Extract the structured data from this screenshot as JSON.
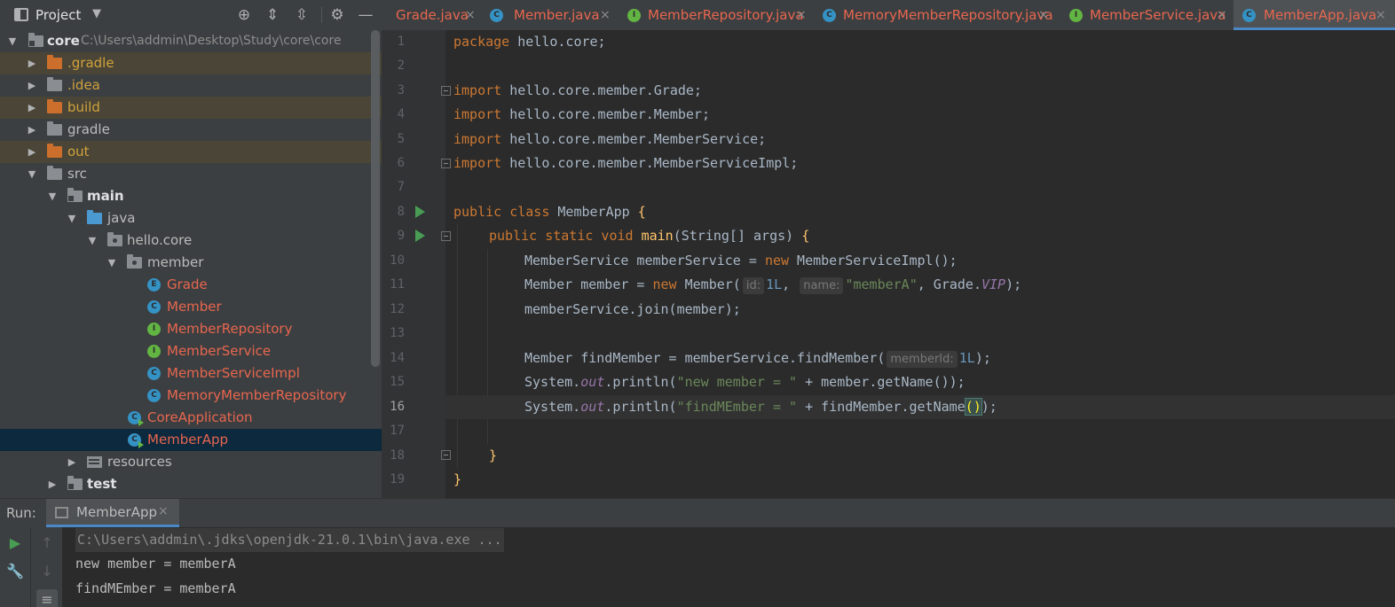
{
  "project_panel": {
    "title": "Project",
    "tree": [
      {
        "label": "core",
        "path": "C:\\Users\\addmin\\Desktop\\Study\\core\\core"
      },
      {
        "label": ".gradle"
      },
      {
        "label": ".idea"
      },
      {
        "label": "build"
      },
      {
        "label": "gradle"
      },
      {
        "label": "out"
      },
      {
        "label": "src"
      },
      {
        "label": "main"
      },
      {
        "label": "java"
      },
      {
        "label": "hello.core"
      },
      {
        "label": "member"
      },
      {
        "label": "Grade"
      },
      {
        "label": "Member"
      },
      {
        "label": "MemberRepository"
      },
      {
        "label": "MemberService"
      },
      {
        "label": "MemberServiceImpl"
      },
      {
        "label": "MemoryMemberRepository"
      },
      {
        "label": "CoreApplication"
      },
      {
        "label": "MemberApp"
      },
      {
        "label": "resources"
      },
      {
        "label": "test"
      }
    ]
  },
  "editor_tabs": [
    {
      "label": "Grade.java",
      "icon": "enum-icon"
    },
    {
      "label": "Member.java",
      "icon": "class-icon"
    },
    {
      "label": "MemberRepository.java",
      "icon": "interface-icon"
    },
    {
      "label": "MemoryMemberRepository.java",
      "icon": "class-icon"
    },
    {
      "label": "MemberService.java",
      "icon": "interface-icon"
    },
    {
      "label": "MemberApp.java",
      "icon": "runnable-class-icon",
      "active": true
    }
  ],
  "editor": {
    "current_line": 16,
    "line_numbers": [
      "1",
      "2",
      "3",
      "4",
      "5",
      "6",
      "7",
      "8",
      "9",
      "10",
      "11",
      "12",
      "13",
      "14",
      "15",
      "16",
      "17",
      "18",
      "19"
    ],
    "code": {
      "l1_kw": "package",
      "l1_rest": " hello.core;",
      "l3_kw": "import",
      "l3_rest": " hello.core.member.Grade;",
      "l4_kw": "import",
      "l4_rest": " hello.core.member.Member;",
      "l5_kw": "import",
      "l5_rest": " hello.core.member.MemberService;",
      "l6_kw": "import",
      "l6_rest": " hello.core.member.MemberServiceImpl;",
      "l8_kw": "public class",
      "l8_name": " MemberApp ",
      "l8_brace": "{",
      "l9_kw": "public static void",
      "l9_fn": "main",
      "l9_rest": "(String[] args) ",
      "l9_brace": "{",
      "l10_a": "MemberService memberService = ",
      "l10_kw": "new",
      "l10_b": " MemberServiceImpl();",
      "l11_a": "Member member = ",
      "l11_kw": "new",
      "l11_b": " Member(",
      "l11_hint1": "id:",
      "l11_num": "1L",
      "l11_c": ",",
      "l11_hint2": "name:",
      "l11_str": "\"memberA\"",
      "l11_d": ", Grade.",
      "l11_static": "VIP",
      "l11_e": ");",
      "l12": "memberService.join(member);",
      "l14_a": "Member findMember = memberService.findMember(",
      "l14_hint": "memberId:",
      "l14_num": "1L",
      "l14_b": ");",
      "l15_a": "System.",
      "l15_static": "out",
      "l15_b": ".println(",
      "l15_str": "\"new member = \"",
      "l15_c": " + member.getName());",
      "l16_a": "System.",
      "l16_static": "out",
      "l16_b": ".println(",
      "l16_str": "\"findMEmber = \"",
      "l16_c": " + findMember.getName",
      "l16_paren": "()",
      "l16_d": ");",
      "l18_brace": "}",
      "l19_brace": "}"
    }
  },
  "run_panel": {
    "label": "Run:",
    "tab_label": "MemberApp",
    "console": [
      "C:\\Users\\addmin\\.jdks\\openjdk-21.0.1\\bin\\java.exe ...",
      "new member = memberA",
      "findMEmber = memberA"
    ]
  }
}
